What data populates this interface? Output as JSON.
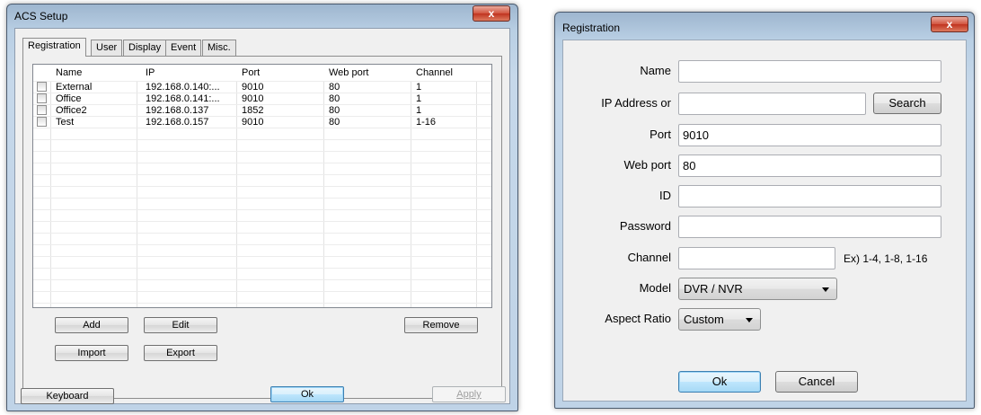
{
  "acs": {
    "title": "ACS Setup",
    "close_glyph": "x",
    "tabs": [
      "Registration",
      "User",
      "Display",
      "Event",
      "Misc."
    ],
    "columns": [
      "Name",
      "IP",
      "Port",
      "Web port",
      "Channel"
    ],
    "rows": [
      {
        "checked": false,
        "name": "External",
        "ip": "192.168.0.140:...",
        "port": "9010",
        "web_port": "80",
        "channel": "1"
      },
      {
        "checked": false,
        "name": "Office",
        "ip": "192.168.0.141:...",
        "port": "9010",
        "web_port": "80",
        "channel": "1"
      },
      {
        "checked": false,
        "name": "Office2",
        "ip": "192.168.0.137",
        "port": "1852",
        "web_port": "80",
        "channel": "1"
      },
      {
        "checked": false,
        "name": "Test",
        "ip": "192.168.0.157",
        "port": "9010",
        "web_port": "80",
        "channel": "1-16"
      }
    ],
    "buttons": {
      "add": "Add",
      "edit": "Edit",
      "remove": "Remove",
      "import": "Import",
      "export": "Export",
      "keyboard": "Keyboard",
      "ok": "Ok",
      "apply": "Apply"
    }
  },
  "registration": {
    "title": "Registration",
    "close_glyph": "x",
    "labels": {
      "name": "Name",
      "ip": "IP Address or",
      "port": "Port",
      "web_port": "Web port",
      "id": "ID",
      "password": "Password",
      "channel": "Channel",
      "model": "Model",
      "aspect_ratio": "Aspect Ratio"
    },
    "values": {
      "name": "",
      "ip": "",
      "port": "9010",
      "web_port": "80",
      "id": "",
      "password": "",
      "channel": ""
    },
    "channel_hint": "Ex) 1-4, 1-8, 1-16",
    "model_selected": "DVR / NVR",
    "aspect_selected": "Custom",
    "buttons": {
      "search": "Search",
      "ok": "Ok",
      "cancel": "Cancel"
    }
  }
}
